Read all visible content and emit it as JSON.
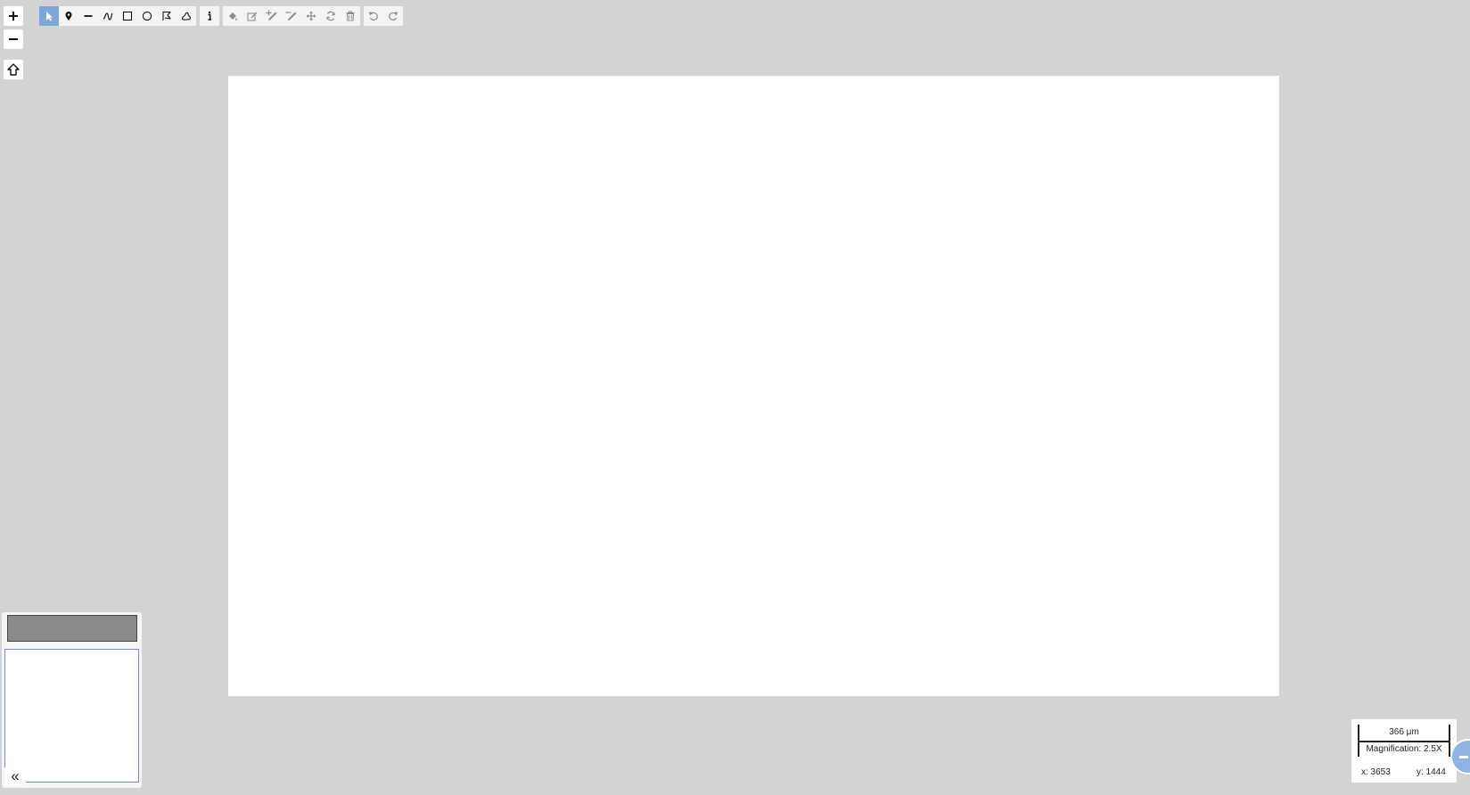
{
  "zoom": {
    "zoom_in_icon": "plus-icon",
    "zoom_out_icon": "minus-icon",
    "home_icon": "home-icon"
  },
  "toolbar": {
    "tools": [
      {
        "name": "select-tool",
        "icon": "cursor-arrow-icon",
        "active": true
      },
      {
        "name": "point-tool",
        "icon": "map-marker-icon"
      },
      {
        "name": "line-tool",
        "icon": "line-icon"
      },
      {
        "name": "freehand-line-tool",
        "icon": "freehand-line-icon"
      },
      {
        "name": "rectangle-tool",
        "icon": "square-icon"
      },
      {
        "name": "ellipse-tool",
        "icon": "circle-icon"
      },
      {
        "name": "polygon-tool",
        "icon": "polygon-icon"
      },
      {
        "name": "freehand-polygon-tool",
        "icon": "freehand-polygon-icon"
      }
    ],
    "info_icon": "info-icon",
    "edit_tools": [
      {
        "name": "fill-tool",
        "icon": "paint-bucket-icon"
      },
      {
        "name": "edit-tool",
        "icon": "edit-icon"
      },
      {
        "name": "add-vertex-tool",
        "icon": "pencil-plus-icon"
      },
      {
        "name": "remove-vertex-tool",
        "icon": "pencil-minus-icon"
      },
      {
        "name": "move-tool",
        "icon": "move-arrows-icon"
      },
      {
        "name": "rotate-tool",
        "icon": "rotate-icon"
      },
      {
        "name": "delete-tool",
        "icon": "trash-icon"
      }
    ],
    "history_tools": [
      {
        "name": "undo-tool",
        "icon": "undo-icon"
      },
      {
        "name": "redo-tool",
        "icon": "redo-icon"
      }
    ]
  },
  "overview": {
    "collapse_label": "«"
  },
  "scale": {
    "label": "366 μm",
    "magnification": "Magnification: 2.5X"
  },
  "cursor": {
    "x_label": "x: 3653",
    "y_label": "y: 1444"
  },
  "colors": {
    "background": "#d3d3d3",
    "slide": "#ffffff",
    "active_tool": "#7ba7db",
    "overview_border": "#6b8fc8"
  }
}
